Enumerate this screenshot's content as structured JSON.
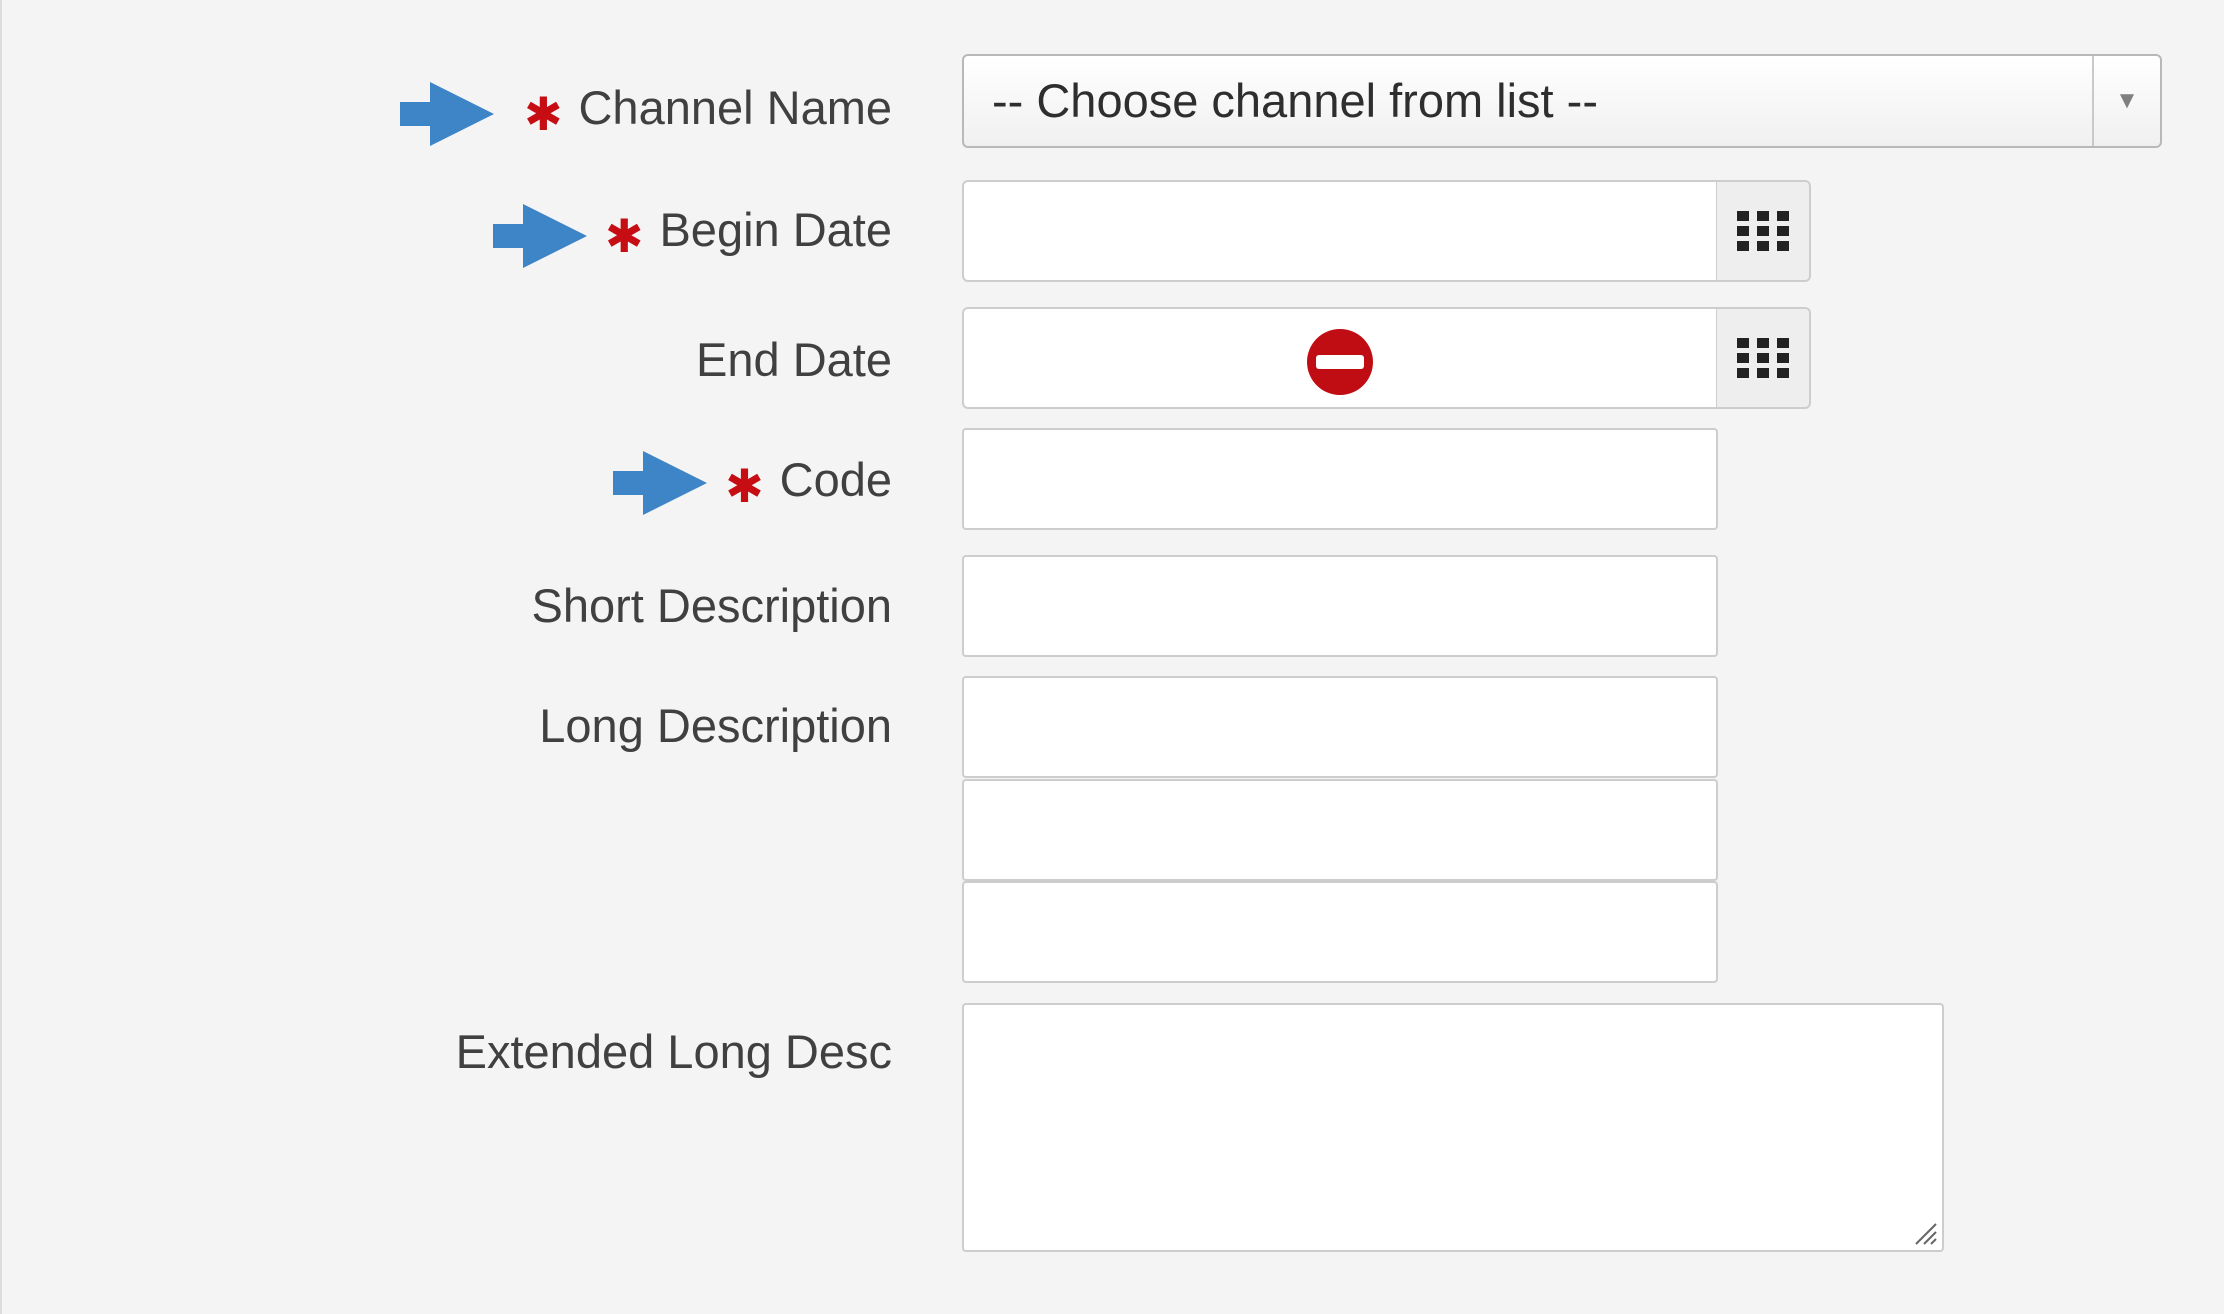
{
  "colors": {
    "arrow": "#3d85c6",
    "required_marker": "#c60d14",
    "no_entry": "#c00d14"
  },
  "form": {
    "channel_name": {
      "label": "Channel Name",
      "required": "✱",
      "placeholder": "-- Choose channel from list --",
      "dropdown_icon": "chevron-down-icon"
    },
    "begin_date": {
      "label": "Begin Date",
      "required": "✱",
      "value": "",
      "calendar_icon": "calendar-grid-icon"
    },
    "end_date": {
      "label": "End Date",
      "value": "",
      "calendar_icon": "calendar-grid-icon",
      "cursor_icon": "not-allowed-icon"
    },
    "code": {
      "label": "Code",
      "required": "✱",
      "value": ""
    },
    "short_description": {
      "label": "Short Description",
      "value": ""
    },
    "long_description": {
      "label": "Long Description",
      "values": [
        "",
        "",
        ""
      ]
    },
    "extended_long_desc": {
      "label": "Extended Long Desc",
      "value": ""
    }
  }
}
